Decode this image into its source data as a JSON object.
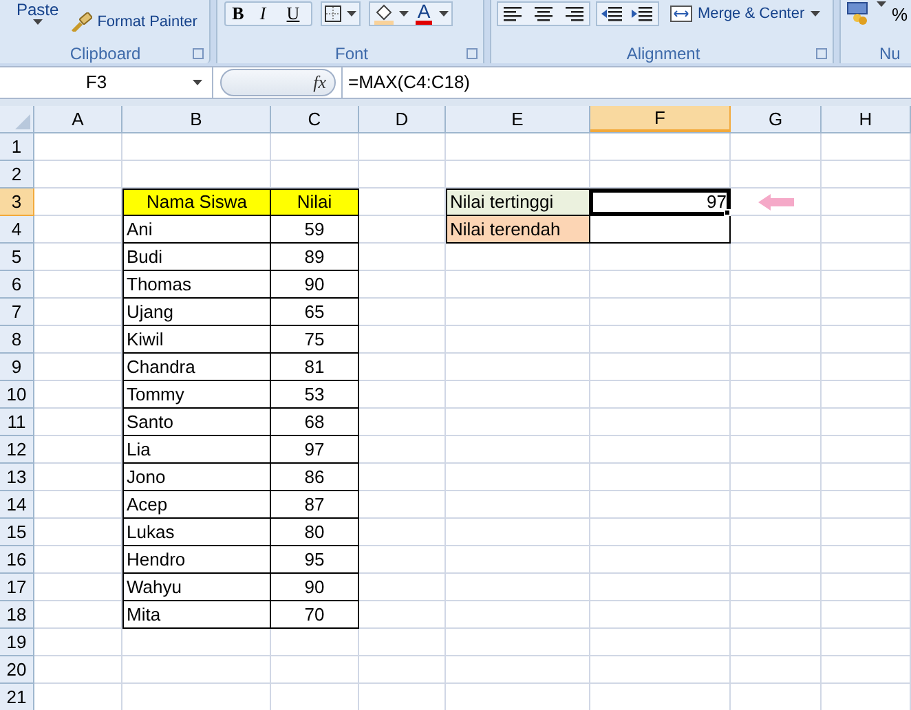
{
  "clipboard": {
    "paste": "Paste",
    "format_painter": "Format Painter",
    "label": "Clipboard"
  },
  "font": {
    "bold": "B",
    "italic": "I",
    "underline": "U",
    "font_color": "A",
    "label": "Font"
  },
  "alignment": {
    "merge": "Merge & Center",
    "label": "Alignment"
  },
  "number": {
    "percent": "%",
    "label": "Nu"
  },
  "name_box": "F3",
  "fx": "fx",
  "formula": "=MAX(C4:C18)",
  "columns": [
    {
      "label": "A",
      "selected": false
    },
    {
      "label": "B",
      "selected": false
    },
    {
      "label": "C",
      "selected": false
    },
    {
      "label": "D",
      "selected": false
    },
    {
      "label": "E",
      "selected": false
    },
    {
      "label": "F",
      "selected": true
    },
    {
      "label": "G",
      "selected": false
    },
    {
      "label": "H",
      "selected": false
    }
  ],
  "rows": [
    {
      "label": "1",
      "selected": false
    },
    {
      "label": "2",
      "selected": false
    },
    {
      "label": "3",
      "selected": true
    },
    {
      "label": "4",
      "selected": false
    },
    {
      "label": "5",
      "selected": false
    },
    {
      "label": "6",
      "selected": false
    },
    {
      "label": "7",
      "selected": false
    },
    {
      "label": "8",
      "selected": false
    },
    {
      "label": "9",
      "selected": false
    },
    {
      "label": "10",
      "selected": false
    },
    {
      "label": "11",
      "selected": false
    },
    {
      "label": "12",
      "selected": false
    },
    {
      "label": "13",
      "selected": false
    },
    {
      "label": "14",
      "selected": false
    },
    {
      "label": "15",
      "selected": false
    },
    {
      "label": "16",
      "selected": false
    },
    {
      "label": "17",
      "selected": false
    },
    {
      "label": "18",
      "selected": false
    },
    {
      "label": "19",
      "selected": false
    },
    {
      "label": "20",
      "selected": false
    },
    {
      "label": "21",
      "selected": false
    }
  ],
  "student_table": {
    "headers": [
      "Nama Siswa",
      "Nilai"
    ],
    "records": [
      {
        "name": "Ani",
        "score": "59"
      },
      {
        "name": "Budi",
        "score": "89"
      },
      {
        "name": "Thomas",
        "score": "90"
      },
      {
        "name": "Ujang",
        "score": "65"
      },
      {
        "name": "Kiwil",
        "score": "75"
      },
      {
        "name": "Chandra",
        "score": "81"
      },
      {
        "name": "Tommy",
        "score": "53"
      },
      {
        "name": "Santo",
        "score": "68"
      },
      {
        "name": "Lia",
        "score": "97"
      },
      {
        "name": "Jono",
        "score": "86"
      },
      {
        "name": "Acep",
        "score": "87"
      },
      {
        "name": "Lukas",
        "score": "80"
      },
      {
        "name": "Hendro",
        "score": "95"
      },
      {
        "name": "Wahyu",
        "score": "90"
      },
      {
        "name": "Mita",
        "score": "70"
      }
    ]
  },
  "summary": [
    {
      "label": "Nilai tertinggi",
      "color": "#ebf1de",
      "value": "97",
      "selected": true
    },
    {
      "label": "Nilai terendah",
      "color": "#fcd5b4",
      "selected": false
    }
  ]
}
